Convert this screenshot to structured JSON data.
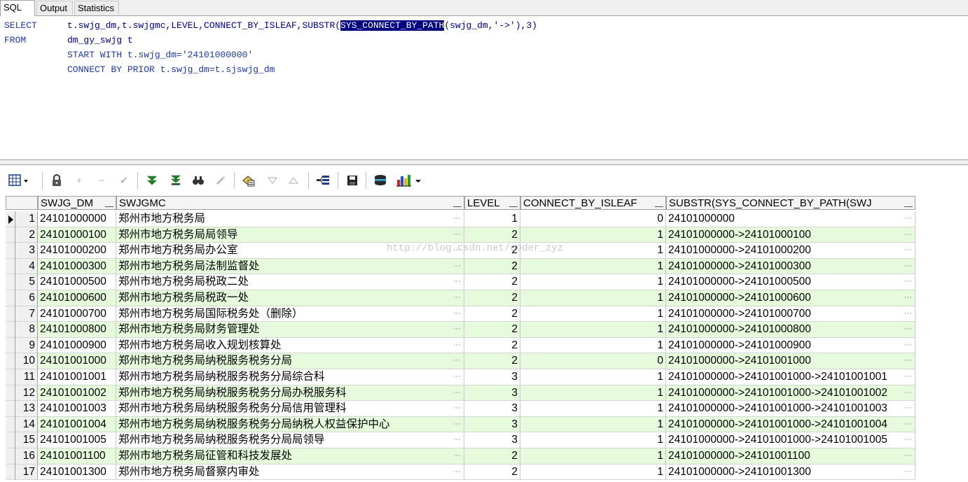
{
  "tabs": [
    "SQL",
    "Output",
    "Statistics"
  ],
  "sql": {
    "select_kw": "SELECT",
    "select_cols_a": "t.swjg_dm,t.swjgmc,LEVEL,CONNECT_BY_ISLEAF,SUBSTR(",
    "select_highlight": "SYS_CONNECT_BY_PATH",
    "select_cols_b": "(swjg_dm,'->'),3)",
    "from_kw": "FROM",
    "from_table": "dm_gy_swjg t",
    "start_with": "START WITH t.swjg_dm='24101000000'",
    "connect_by": "CONNECT BY PRIOR t.swjg_dm=t.sjswjg_dm"
  },
  "watermark": "http://blog.csdn.net/coder_zyz",
  "grid": {
    "columns": [
      "SWJG_DM",
      "SWJGMC",
      "LEVEL",
      "CONNECT_BY_ISLEAF",
      "SUBSTR(SYS_CONNECT_BY_PATH(SWJ"
    ],
    "ellipsis": "···",
    "rows": [
      {
        "n": "1",
        "dm": "24101000000",
        "mc": "郑州市地方税务局",
        "level": "1",
        "leaf": "0",
        "path": "24101000000"
      },
      {
        "n": "2",
        "dm": "24101000100",
        "mc": "郑州市地方税务局局领导",
        "level": "2",
        "leaf": "1",
        "path": "24101000000->24101000100"
      },
      {
        "n": "3",
        "dm": "24101000200",
        "mc": "郑州市地方税务局办公室",
        "level": "2",
        "leaf": "1",
        "path": "24101000000->24101000200"
      },
      {
        "n": "4",
        "dm": "24101000300",
        "mc": "郑州市地方税务局法制监督处",
        "level": "2",
        "leaf": "1",
        "path": "24101000000->24101000300"
      },
      {
        "n": "5",
        "dm": "24101000500",
        "mc": "郑州市地方税务局税政二处",
        "level": "2",
        "leaf": "1",
        "path": "24101000000->24101000500"
      },
      {
        "n": "6",
        "dm": "24101000600",
        "mc": "郑州市地方税务局税政一处",
        "level": "2",
        "leaf": "1",
        "path": "24101000000->24101000600"
      },
      {
        "n": "7",
        "dm": "24101000700",
        "mc": "郑州市地方税务局国际税务处（删除）",
        "level": "2",
        "leaf": "1",
        "path": "24101000000->24101000700"
      },
      {
        "n": "8",
        "dm": "24101000800",
        "mc": "郑州市地方税务局财务管理处",
        "level": "2",
        "leaf": "1",
        "path": "24101000000->24101000800"
      },
      {
        "n": "9",
        "dm": "24101000900",
        "mc": "郑州市地方税务局收入规划核算处",
        "level": "2",
        "leaf": "1",
        "path": "24101000000->24101000900"
      },
      {
        "n": "10",
        "dm": "24101001000",
        "mc": "郑州市地方税务局纳税服务税务分局",
        "level": "2",
        "leaf": "0",
        "path": "24101000000->24101001000"
      },
      {
        "n": "11",
        "dm": "24101001001",
        "mc": "郑州市地方税务局纳税服务税务分局综合科",
        "level": "3",
        "leaf": "1",
        "path": "24101000000->24101001000->24101001001"
      },
      {
        "n": "12",
        "dm": "24101001002",
        "mc": "郑州市地方税务局纳税服务税务分局办税服务科",
        "level": "3",
        "leaf": "1",
        "path": "24101000000->24101001000->24101001002"
      },
      {
        "n": "13",
        "dm": "24101001003",
        "mc": "郑州市地方税务局纳税服务税务分局信用管理科",
        "level": "3",
        "leaf": "1",
        "path": "24101000000->24101001000->24101001003"
      },
      {
        "n": "14",
        "dm": "24101001004",
        "mc": "郑州市地方税务局纳税服务税务分局纳税人权益保护中心",
        "level": "3",
        "leaf": "1",
        "path": "24101000000->24101001000->24101001004"
      },
      {
        "n": "15",
        "dm": "24101001005",
        "mc": "郑州市地方税务局纳税服务税务分局局领导",
        "level": "3",
        "leaf": "1",
        "path": "24101000000->24101001000->24101001005"
      },
      {
        "n": "16",
        "dm": "24101001100",
        "mc": "郑州市地方税务局征管和科技发展处",
        "level": "2",
        "leaf": "1",
        "path": "24101000000->24101001100"
      },
      {
        "n": "17",
        "dm": "24101001300",
        "mc": "郑州市地方税务局督察内审处",
        "level": "2",
        "leaf": "1",
        "path": "24101000000->24101001300"
      }
    ]
  },
  "toolbar_icons": [
    "grid-options-icon",
    "lock-icon",
    "add-record-icon",
    "delete-record-icon",
    "post-edit-icon",
    "fetch-next-icon",
    "fetch-last-icon",
    "find-icon",
    "clear-icon",
    "query-by-example-icon",
    "filter-down-icon",
    "filter-up-icon",
    "single-record-view-icon",
    "save-icon",
    "export-icon",
    "chart-icon"
  ]
}
